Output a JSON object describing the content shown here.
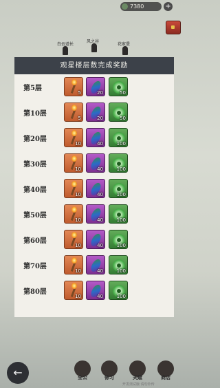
{
  "topbar": {
    "coins": "7380",
    "plus": "+"
  },
  "npcs": [
    {
      "name": "白云道长"
    },
    {
      "name": "风之谷"
    },
    {
      "name": "花家堡"
    }
  ],
  "panel": {
    "title": "观星楼层数完成奖励",
    "rows": [
      {
        "label": "第5层",
        "items": [
          {
            "count": "5"
          },
          {
            "count": "20"
          },
          {
            "count": "50"
          }
        ]
      },
      {
        "label": "第10层",
        "items": [
          {
            "count": "5"
          },
          {
            "count": "20"
          },
          {
            "count": "50"
          }
        ]
      },
      {
        "label": "第20层",
        "items": [
          {
            "count": "10"
          },
          {
            "count": "40"
          },
          {
            "count": "100"
          }
        ]
      },
      {
        "label": "第30层",
        "items": [
          {
            "count": "10"
          },
          {
            "count": "40"
          },
          {
            "count": "100"
          }
        ]
      },
      {
        "label": "第40层",
        "items": [
          {
            "count": "10"
          },
          {
            "count": "40"
          },
          {
            "count": "100"
          }
        ]
      },
      {
        "label": "第50层",
        "items": [
          {
            "count": "10"
          },
          {
            "count": "40"
          },
          {
            "count": "100"
          }
        ]
      },
      {
        "label": "第60层",
        "items": [
          {
            "count": "10"
          },
          {
            "count": "40"
          },
          {
            "count": "100"
          }
        ]
      },
      {
        "label": "第70层",
        "items": [
          {
            "count": "10"
          },
          {
            "count": "40"
          },
          {
            "count": "100"
          }
        ]
      },
      {
        "label": "第80层",
        "items": [
          {
            "count": "10"
          },
          {
            "count": "40"
          },
          {
            "count": "100"
          }
        ]
      }
    ]
  },
  "bottom_nav": {
    "back": "←",
    "items": [
      {
        "label": "全公"
      },
      {
        "label": "修习"
      },
      {
        "label": "天赋"
      },
      {
        "label": "商店"
      }
    ]
  },
  "footer_note": "开发测试版 请勿外传",
  "colors": {
    "panel_header": "#3c4149",
    "orange_item": "#d9703f",
    "purple_item": "#9a46ad",
    "green_item": "#4f9a48"
  }
}
